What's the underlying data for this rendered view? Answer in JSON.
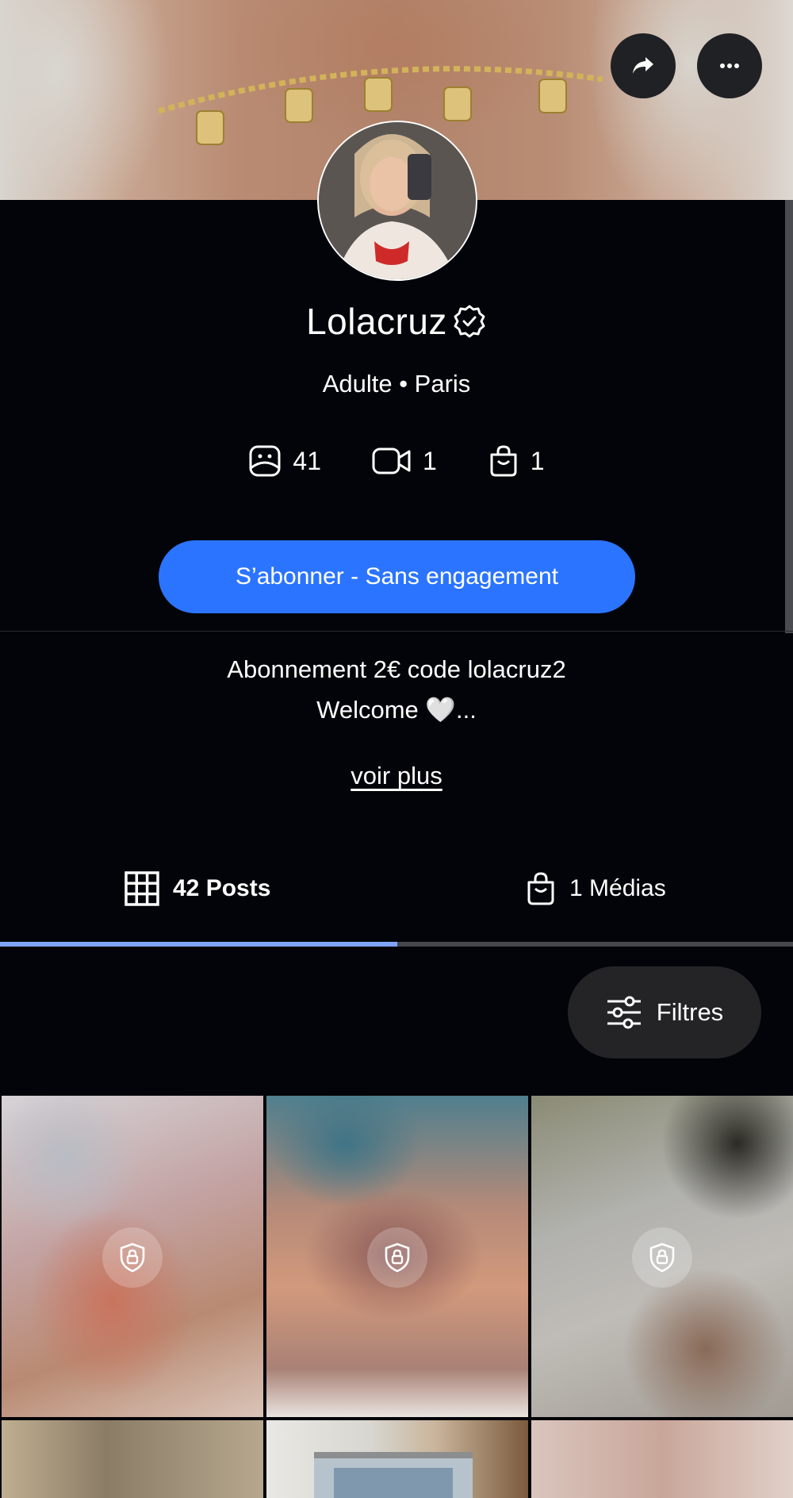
{
  "profile": {
    "name": "Lolacruz",
    "subtitle": "Adulte • Paris"
  },
  "stats": {
    "photos": "41",
    "videos": "1",
    "products": "1"
  },
  "subscribe": {
    "label": "S’abonner - Sans engagement"
  },
  "bio": {
    "line1": "Abonnement 2€ code lolacruz2",
    "line2": "Welcome 🤍...",
    "see_more": "voir plus"
  },
  "tabs": [
    {
      "label": "42 Posts",
      "icon": "grid-icon",
      "active": true
    },
    {
      "label": "1 Médias",
      "icon": "shopping-bag-icon",
      "active": false
    }
  ],
  "filter": {
    "label": "Filtres"
  },
  "colors": {
    "background": "#030409",
    "accent": "#2b74ff",
    "tab_active": "#7ea4ff",
    "button_dark": "#202124"
  },
  "posts": [
    {
      "locked": true
    },
    {
      "locked": true
    },
    {
      "locked": true
    },
    {
      "locked": false
    },
    {
      "locked": false
    },
    {
      "locked": false
    }
  ]
}
